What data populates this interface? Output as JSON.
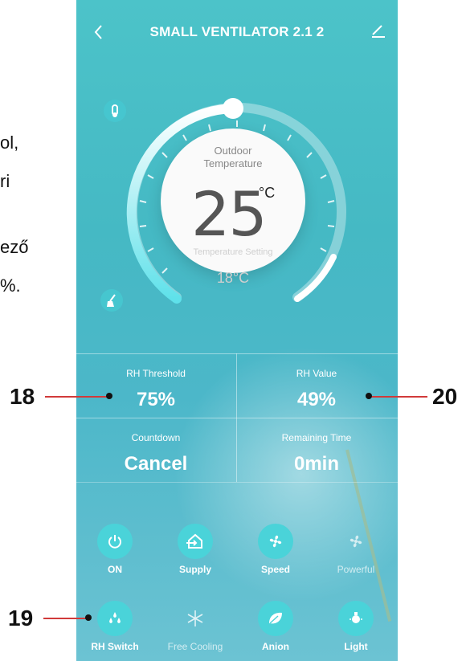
{
  "left_text": [
    "ol,",
    "ri",
    "ező",
    "%."
  ],
  "app": {
    "title": "SMALL VENTILATOR 2.1 2",
    "dial": {
      "label_line1": "Outdoor",
      "label_line2": "Temperature",
      "value": "25",
      "unit": "°C",
      "setting_label": "Temperature Setting",
      "setting_value": "18°C"
    },
    "stats": {
      "rh_threshold_label": "RH Threshold",
      "rh_threshold_value": "75%",
      "rh_value_label": "RH Value",
      "rh_value_value": "49%",
      "countdown_label": "Countdown",
      "countdown_value": "Cancel",
      "remaining_label": "Remaining Time",
      "remaining_value": "0min"
    },
    "buttons_row1": [
      "ON",
      "Supply",
      "Speed",
      "Powerful"
    ],
    "buttons_row2": [
      "RH Switch",
      "Free Cooling",
      "Anion",
      "Light"
    ]
  },
  "annotations": {
    "a18": "18",
    "a19": "19",
    "a20": "20"
  },
  "colors": {
    "accent": "#4ad3d9",
    "annotation_line": "#d13a3a"
  }
}
